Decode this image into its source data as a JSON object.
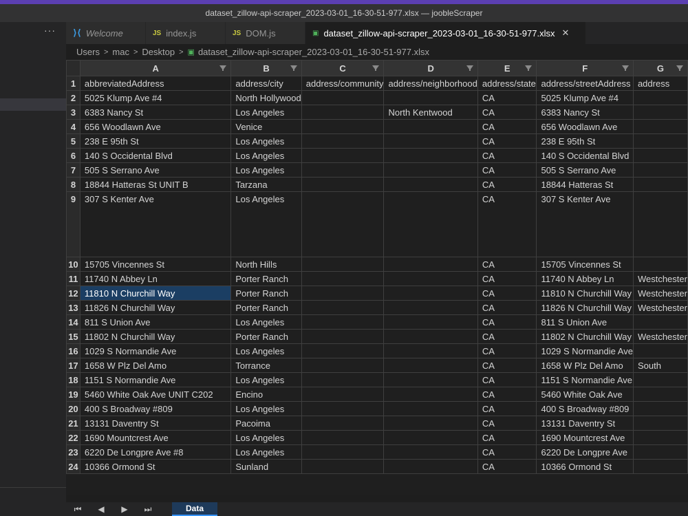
{
  "window": {
    "title": "dataset_zillow-api-scraper_2023-03-01_16-30-51-977.xlsx — joobleScraper"
  },
  "sidebar": {
    "more_label": "···"
  },
  "tabs": [
    {
      "label": "Welcome",
      "icon": "vscode-icon"
    },
    {
      "label": "index.js",
      "icon": "js-icon"
    },
    {
      "label": "DOM.js",
      "icon": "js-icon"
    },
    {
      "label": "dataset_zillow-api-scraper_2023-03-01_16-30-51-977.xlsx",
      "icon": "excel-icon",
      "close": "✕"
    }
  ],
  "breadcrumb": [
    "Users",
    "mac",
    "Desktop",
    "dataset_zillow-api-scraper_2023-03-01_16-30-51-977.xlsx"
  ],
  "columns": [
    "A",
    "B",
    "C",
    "D",
    "E",
    "F",
    "G"
  ],
  "rows": [
    {
      "n": "1",
      "cells": [
        "abbreviatedAddress",
        "address/city",
        "address/community",
        "address/neighborhood",
        "address/state",
        "address/streetAddress",
        "address"
      ]
    },
    {
      "n": "2",
      "cells": [
        "5025 Klump Ave #4",
        "North Hollywood",
        "",
        "",
        "CA",
        "5025 Klump Ave #4",
        ""
      ]
    },
    {
      "n": "3",
      "cells": [
        "6383 Nancy St",
        "Los Angeles",
        "",
        "North Kentwood",
        "CA",
        "6383 Nancy St",
        ""
      ]
    },
    {
      "n": "4",
      "cells": [
        "656 Woodlawn Ave",
        "Venice",
        "",
        "",
        "CA",
        "656 Woodlawn Ave",
        ""
      ]
    },
    {
      "n": "5",
      "cells": [
        "238 E 95th St",
        "Los Angeles",
        "",
        "",
        "CA",
        "238 E 95th St",
        ""
      ]
    },
    {
      "n": "6",
      "cells": [
        "140 S Occidental Blvd",
        "Los Angeles",
        "",
        "",
        "CA",
        "140 S Occidental Blvd",
        ""
      ]
    },
    {
      "n": "7",
      "cells": [
        "505 S Serrano Ave",
        "Los Angeles",
        "",
        "",
        "CA",
        "505 S Serrano Ave",
        ""
      ]
    },
    {
      "n": "8",
      "cells": [
        "18844 Hatteras St UNIT B",
        "Tarzana",
        "",
        "",
        "CA",
        "18844 Hatteras St",
        ""
      ]
    },
    {
      "n": "9",
      "cells": [
        "307 S Kenter Ave",
        "Los Angeles",
        "",
        "",
        "CA",
        "307 S Kenter Ave",
        ""
      ]
    },
    {
      "n": "10",
      "cells": [
        "15705 Vincennes St",
        "North Hills",
        "",
        "",
        "CA",
        "15705 Vincennes St",
        ""
      ]
    },
    {
      "n": "11",
      "cells": [
        "11740 N Abbey Ln",
        "Porter Ranch",
        "",
        "",
        "CA",
        "11740 N Abbey Ln",
        "Westchester"
      ]
    },
    {
      "n": "12",
      "cells": [
        "11810 N Churchill Way",
        "Porter Ranch",
        "",
        "",
        "CA",
        "11810 N Churchill Way",
        "Westchester"
      ]
    },
    {
      "n": "13",
      "cells": [
        "11826 N Churchill Way",
        "Porter Ranch",
        "",
        "",
        "CA",
        "11826 N Churchill Way",
        "Westchester"
      ]
    },
    {
      "n": "14",
      "cells": [
        "811 S Union Ave",
        "Los Angeles",
        "",
        "",
        "CA",
        "811 S Union Ave",
        ""
      ]
    },
    {
      "n": "15",
      "cells": [
        "11802 N Churchill Way",
        "Porter Ranch",
        "",
        "",
        "CA",
        "11802 N Churchill Way",
        "Westchester"
      ]
    },
    {
      "n": "16",
      "cells": [
        "1029 S Normandie Ave",
        "Los Angeles",
        "",
        "",
        "CA",
        "1029 S Normandie Ave",
        ""
      ]
    },
    {
      "n": "17",
      "cells": [
        "1658 W Plz Del Amo",
        "Torrance",
        "",
        "",
        "CA",
        "1658 W Plz Del Amo",
        "South"
      ]
    },
    {
      "n": "18",
      "cells": [
        "1151 S Normandie Ave",
        "Los Angeles",
        "",
        "",
        "CA",
        "1151 S Normandie Ave",
        ""
      ]
    },
    {
      "n": "19",
      "cells": [
        "5460 White Oak Ave UNIT C202",
        "Encino",
        "",
        "",
        "CA",
        "5460 White Oak Ave",
        ""
      ]
    },
    {
      "n": "20",
      "cells": [
        "400 S Broadway #809",
        "Los Angeles",
        "",
        "",
        "CA",
        "400 S Broadway #809",
        ""
      ]
    },
    {
      "n": "21",
      "cells": [
        "13131 Daventry St",
        "Pacoima",
        "",
        "",
        "CA",
        "13131 Daventry St",
        ""
      ]
    },
    {
      "n": "22",
      "cells": [
        "1690 Mountcrest Ave",
        "Los Angeles",
        "",
        "",
        "CA",
        "1690 Mountcrest Ave",
        ""
      ]
    },
    {
      "n": "23",
      "cells": [
        "6220 De Longpre Ave #8",
        "Los Angeles",
        "",
        "",
        "CA",
        "6220 De Longpre Ave",
        ""
      ]
    },
    {
      "n": "24",
      "cells": [
        "10366 Ormond St",
        "Sunland",
        "",
        "",
        "CA",
        "10366 Ormond St",
        ""
      ]
    }
  ],
  "selected_cell": "A12",
  "sheet_nav": [
    "⏮",
    "◀",
    "▶",
    "⏭"
  ],
  "sheets": [
    "Data"
  ]
}
